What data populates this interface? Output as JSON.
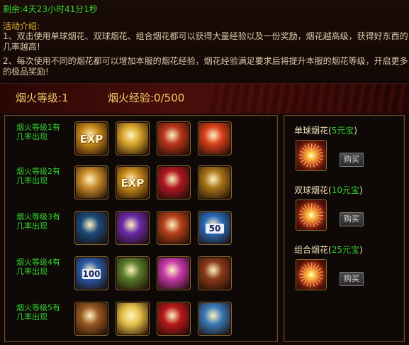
{
  "timer": "剩余:4天23小时41分1秒",
  "intro": {
    "title": "活动介绍:",
    "lines": [
      "1、双击使用单球烟花、双球烟花、组合烟花都可以获得大量经验以及一份奖励，烟花越高级，获得好东西的",
      "几率越高!",
      "2、每次使用不同的烟花都可以增加本服的烟花经验，烟花经验满足要求后将提升本服的烟花等级，开启更多",
      "的极品奖励!"
    ]
  },
  "status": {
    "level": "烟火等级:1",
    "exp": "烟火经验:0/500"
  },
  "tiers": [
    {
      "label": "烟火等级1有几率出现",
      "items": [
        {
          "name": "exp-scroll-icon",
          "text": "EXP",
          "color": "#c98a1a"
        },
        {
          "name": "gold-ingot-icon",
          "text": "",
          "color": "#d9a52a"
        },
        {
          "name": "lion-emblem-icon",
          "text": "",
          "color": "#b8361a"
        },
        {
          "name": "red-orb-icon",
          "text": "",
          "color": "#d8401c"
        }
      ]
    },
    {
      "label": "烟火等级2有几率出现",
      "items": [
        {
          "name": "crystal-orb-icon",
          "text": "",
          "color": "#c78a2a"
        },
        {
          "name": "exp-scroll-icon",
          "text": "EXP",
          "color": "#c98a1a"
        },
        {
          "name": "red-crystal-icon",
          "text": "",
          "color": "#b01822"
        },
        {
          "name": "treasure-chest-icon",
          "text": "",
          "color": "#a8741a"
        }
      ]
    },
    {
      "label": "烟火等级3有几率出现",
      "items": [
        {
          "name": "gray-gear-gem-icon",
          "text": "",
          "color": "#1a4a7a"
        },
        {
          "name": "purple-flower-icon",
          "text": "",
          "color": "#6a2aa8"
        },
        {
          "name": "red-treasure-chest-icon",
          "text": "",
          "color": "#b4401a"
        },
        {
          "name": "blue-card-50-icon",
          "text": "50",
          "color": "#2a6ab8"
        }
      ]
    },
    {
      "label": "烟火等级4有几率出现",
      "items": [
        {
          "name": "blue-card-100-icon",
          "text": "100",
          "color": "#2a5aa8"
        },
        {
          "name": "jade-talisman-icon",
          "text": "",
          "color": "#5a7a2a"
        },
        {
          "name": "pink-gem-icon",
          "text": "",
          "color": "#c83aa8"
        },
        {
          "name": "brown-pouch-icon",
          "text": "",
          "color": "#8a3a1a"
        }
      ]
    },
    {
      "label": "烟火等级5有几率出现",
      "items": [
        {
          "name": "bronze-pouch-icon",
          "text": "",
          "color": "#9a5a22"
        },
        {
          "name": "dice-icon",
          "text": "",
          "color": "#e8c24a"
        },
        {
          "name": "red-sword-icon",
          "text": "",
          "color": "#b81a1a"
        },
        {
          "name": "blue-drill-icon",
          "text": "",
          "color": "#3a7ab8"
        }
      ]
    }
  ],
  "fireworks": [
    {
      "name": "单球烟花",
      "price": "5元宝",
      "buy": "购买"
    },
    {
      "name": "双球烟花",
      "price": "10元宝",
      "buy": "购买"
    },
    {
      "name": "组合烟花",
      "price": "25元宝",
      "buy": "购买"
    }
  ],
  "colors": {
    "green": "#31d431",
    "gold": "#f0cc6a",
    "border": "#6b4a22"
  }
}
